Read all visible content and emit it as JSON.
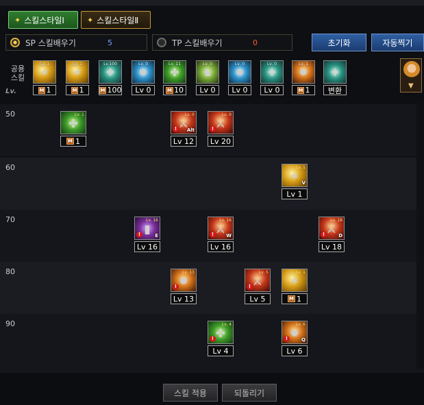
{
  "tabs": [
    {
      "label": "스킬스타일Ⅰ",
      "active": true
    },
    {
      "label": "스킬스타일Ⅱ",
      "active": false
    }
  ],
  "points": {
    "sp_label": "SP 스킬배우기",
    "sp_value": "5",
    "tp_label": "TP 스킬배우기",
    "tp_value": "0"
  },
  "buttons": {
    "reset": "초기화",
    "auto": "자동찍기",
    "apply": "스킬 적용",
    "revert": "되돌리기"
  },
  "shared": {
    "label": "공용\n스킬",
    "lv_header": "Lv.",
    "skills": [
      {
        "mini": "Lv. 1",
        "value": "1",
        "badge": "M",
        "icon": "golden-spin-icon",
        "color": "gold"
      },
      {
        "mini": "Lv. 1",
        "value": "1",
        "badge": "M",
        "icon": "golden-dash-icon",
        "color": "gold"
      },
      {
        "mini": "Lv.100",
        "value": "100",
        "badge": "M",
        "icon": "teal-blades-icon",
        "color": "teal"
      },
      {
        "mini": "Lv. 0",
        "value": "Lv 0",
        "badge": "",
        "icon": "winged-crest-icon",
        "color": "blue"
      },
      {
        "mini": "Lv. 11",
        "value": "10",
        "badge": "M",
        "icon": "target-ring-icon",
        "color": "green"
      },
      {
        "mini": "Lv. 0",
        "value": "Lv 0",
        "badge": "",
        "icon": "fighter-stance-icon",
        "color": "lime"
      },
      {
        "mini": "Lv. 0",
        "value": "Lv 0",
        "badge": "",
        "icon": "eye-vortex-icon",
        "color": "blue"
      },
      {
        "mini": "Lv. 0",
        "value": "Lv 0",
        "badge": "",
        "icon": "figure-aura-icon",
        "color": "teal"
      },
      {
        "mini": "Lv. 1",
        "value": "1",
        "badge": "M",
        "icon": "flame-burst-icon",
        "color": "orange"
      },
      {
        "mini": "",
        "value": "변환",
        "badge": "",
        "icon": "transform-rune-icon",
        "color": "teal"
      }
    ]
  },
  "levels": [
    "50",
    "60",
    "70",
    "80",
    "90"
  ],
  "grid_skills": [
    {
      "row": "50",
      "mini": "Lv. 1",
      "value": "1",
      "badge": "M",
      "warn": false,
      "key": "",
      "icon": "green-claw-icon",
      "color": "green"
    },
    {
      "row": "50",
      "mini": "Lv. 0",
      "value": "Lv 12",
      "badge": "",
      "warn": true,
      "key": "Alt",
      "icon": "red-slash-icon",
      "color": "red"
    },
    {
      "row": "50",
      "mini": "Lv. 0",
      "value": "Lv 20",
      "badge": "",
      "warn": true,
      "key": "",
      "icon": "fire-strike-icon",
      "color": "red"
    },
    {
      "row": "60",
      "mini": "Lv. 1",
      "value": "Lv 1",
      "badge": "",
      "warn": false,
      "key": "V",
      "icon": "lightning-cross-icon",
      "color": "gold"
    },
    {
      "row": "70",
      "mini": "Lv. 16",
      "value": "Lv 16",
      "badge": "",
      "warn": true,
      "key": "E",
      "icon": "crystal-pillar-icon",
      "color": "purple"
    },
    {
      "row": "70",
      "mini": "Lv. 16",
      "value": "Lv 16",
      "badge": "",
      "warn": true,
      "key": "W",
      "icon": "rune-circle-icon",
      "color": "red"
    },
    {
      "row": "70",
      "mini": "Lv. 18",
      "value": "Lv 18",
      "badge": "",
      "warn": true,
      "key": "D",
      "icon": "cross-blades-icon",
      "color": "red"
    },
    {
      "row": "80",
      "mini": "Lv. 13",
      "value": "Lv 13",
      "badge": "",
      "warn": true,
      "key": "",
      "icon": "chain-burst-icon",
      "color": "orange"
    },
    {
      "row": "80",
      "mini": "Lv. 5",
      "value": "Lv 5",
      "badge": "",
      "warn": true,
      "key": "",
      "icon": "flame-pillar-icon",
      "color": "red"
    },
    {
      "row": "80",
      "mini": "Lv. 1",
      "value": "1",
      "badge": "M",
      "warn": false,
      "key": "",
      "icon": "radiant-fan-icon",
      "color": "gold"
    },
    {
      "row": "90",
      "mini": "Lv. 4",
      "value": "Lv 4",
      "badge": "",
      "warn": true,
      "key": "",
      "icon": "beast-roar-icon",
      "color": "green"
    },
    {
      "row": "90",
      "mini": "Lv. 6",
      "value": "Lv 6",
      "badge": "",
      "warn": true,
      "key": "Q",
      "icon": "fire-fist-icon",
      "color": "orange"
    }
  ]
}
